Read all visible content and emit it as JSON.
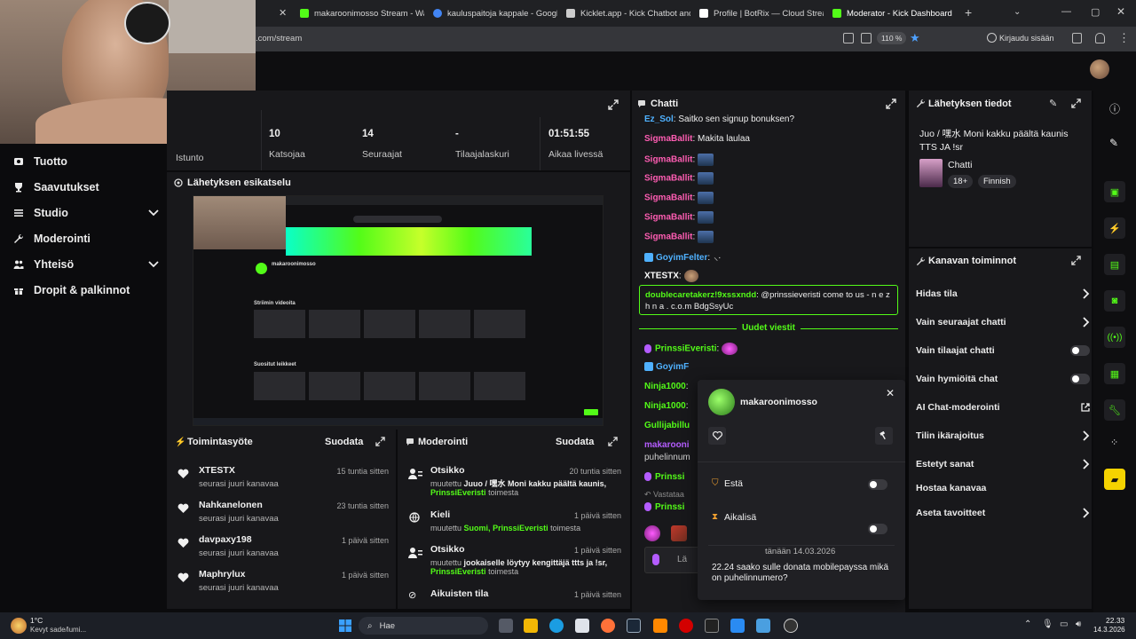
{
  "browser": {
    "tabs": [
      {
        "label": "makaroonimosso Stream - Wat",
        "favicon_color": "#53fc18"
      },
      {
        "label": "kauluspaitoja kappale - Google",
        "favicon_color": "#4285f4"
      },
      {
        "label": "Kicklet.app - Kick Chatbot and",
        "favicon_color": "#cccccc"
      },
      {
        "label": "Profile | BotRix — Cloud Stream",
        "favicon_color": "#ffffff"
      },
      {
        "label": "Moderator - Kick Dashboard",
        "favicon_color": "#53fc18"
      }
    ],
    "url_fragment": ".com/stream",
    "zoom": "110 %",
    "signin_label": "Kirjaudu sisään"
  },
  "leftnav": {
    "items": [
      {
        "label": "Tuotto",
        "icon": "dollar-icon"
      },
      {
        "label": "Saavutukset",
        "icon": "trophy-icon"
      },
      {
        "label": "Studio",
        "icon": "sliders-icon"
      },
      {
        "label": "Moderointi",
        "icon": "wrench-icon"
      },
      {
        "label": "Yhteisö",
        "icon": "people-icon"
      },
      {
        "label": "Dropit & palkinnot",
        "icon": "gift-icon"
      }
    ]
  },
  "stats": {
    "session_label": "Istunto",
    "items": [
      {
        "value": "10",
        "label": "Katsojaa"
      },
      {
        "value": "14",
        "label": "Seuraajat"
      },
      {
        "value": "-",
        "label": "Tilaajalaskuri"
      },
      {
        "value": "01:51:55",
        "label": "Aikaa livessä"
      }
    ]
  },
  "preview": {
    "title": "Lähetyksen esikatselu",
    "inner_channel": "makaroonimosso",
    "inner_section1": "Striimin videoita",
    "inner_section2": "Suositut leikkeet"
  },
  "feed": {
    "title": "Toimintasyöte",
    "filter_label": "Suodata",
    "items": [
      {
        "name": "XTESTX",
        "sub": "seurasi juuri kanavaa",
        "time": "15 tuntia sitten"
      },
      {
        "name": "Nahkanelonen",
        "sub": "seurasi juuri kanavaa",
        "time": "23 tuntia sitten"
      },
      {
        "name": "davpaxy198",
        "sub": "seurasi juuri kanavaa",
        "time": "1 päivä sitten"
      },
      {
        "name": "Maphrylux",
        "sub": "seurasi juuri kanavaa",
        "time": "1 päivä sitten"
      }
    ]
  },
  "modlog": {
    "title": "Moderointi",
    "filter_label": "Suodata",
    "items": [
      {
        "title": "Otsikko",
        "time": "20 tuntia sitten",
        "prefix": "muutettu",
        "value": "Juuo / 嘿水 Moni kakku päältä kaunis,",
        "actor": "PrinssiEveristi",
        "suffix": "toimesta"
      },
      {
        "title": "Kieli",
        "time": "1 päivä sitten",
        "prefix": "muutettu",
        "value": "Suomi,",
        "actor": "PrinssiEveristi",
        "suffix": "toimesta"
      },
      {
        "title": "Otsikko",
        "time": "1 päivä sitten",
        "prefix": "muutettu",
        "value": "jookaiselle löytyy kengittäjä ttts ja !sr,",
        "actor": "PrinssiEveristi",
        "suffix": "toimesta"
      },
      {
        "title": "Aikuisten tila",
        "time": "1 päivä sitten"
      }
    ]
  },
  "chat": {
    "title": "Chatti",
    "messages": [
      {
        "user": "Ez_Sol",
        "color": "#4fb1ff",
        "text": "Saitko sen signup bonuksen?"
      },
      {
        "user": "SigmaBallit",
        "color": "#ff5db3",
        "text": "Makita laulaa"
      },
      {
        "user": "SigmaBallit",
        "color": "#ff5db3",
        "text": ""
      },
      {
        "user": "SigmaBallit",
        "color": "#ff5db3",
        "text": ""
      },
      {
        "user": "SigmaBallit",
        "color": "#ff5db3",
        "text": ""
      },
      {
        "user": "SigmaBallit",
        "color": "#ff5db3",
        "text": ""
      },
      {
        "user": "SigmaBallit",
        "color": "#ff5db3",
        "text": ""
      },
      {
        "user": "GoyimFelter",
        "color": "#4fb1ff",
        "text": ""
      },
      {
        "user": "XTESTX",
        "color": "#ffffff",
        "text": ""
      }
    ],
    "highlight": {
      "user": "doublecaretakerz!9xssxndd",
      "text": "@prinssieveristi come to us - n e z h n a . c.o.m BdgSsyUc"
    },
    "new_messages_label": "Uudet viestit",
    "after": [
      {
        "user": "PrinssiEveristi",
        "color": "#53fc18"
      },
      {
        "user": "GoyimF",
        "color": "#4fb1ff"
      },
      {
        "user": "Ninja1000",
        "color": "#53fc18"
      },
      {
        "user": "Ninja1000",
        "color": "#53fc18"
      },
      {
        "user": "Gullijabillu",
        "color": "#53fc18"
      },
      {
        "user": "makarooni",
        "color": "#b45cff"
      },
      {
        "user": "puhelinnum",
        "color": "#cfcfcf"
      },
      {
        "user": "Prinssi",
        "color": "#53fc18"
      },
      {
        "user": "Vastataa",
        "color": "#8a8a8a"
      },
      {
        "user": "Prinssi",
        "color": "#53fc18"
      }
    ],
    "input_placeholder": "Lä"
  },
  "usercard": {
    "username": "makaroonimosso",
    "ban_label": "Estä",
    "timeout_label": "Aikalisä",
    "date_label": "tänään 14.03.2026",
    "message_time": "22.24",
    "message_text": "saako sulle donata mobilepayssa mikä on puhelinnumero?"
  },
  "streaminfo": {
    "title": "Lähetyksen tiedot",
    "stream_title": "Juo / 嘿水 Moni kakku päältä kaunis TTS JA !sr",
    "category": "Chatti",
    "badge_age": "18+",
    "badge_lang": "Finnish"
  },
  "channelactions": {
    "title": "Kanavan toiminnot",
    "items": [
      {
        "label": "Hidas tila",
        "control": "chevron"
      },
      {
        "label": "Vain seuraajat chatti",
        "control": "chevron"
      },
      {
        "label": "Vain tilaajat chatti",
        "control": "toggle"
      },
      {
        "label": "Vain hymiöitä chat",
        "control": "toggle"
      },
      {
        "label": "AI Chat-moderointi",
        "control": "external"
      },
      {
        "label": "Tilin ikärajoitus",
        "control": "chevron"
      },
      {
        "label": "Estetyt sanat",
        "control": "chevron"
      },
      {
        "label": "Hostaa kanavaa",
        "control": "none"
      },
      {
        "label": "Aseta tavoitteet",
        "control": "chevron"
      }
    ]
  },
  "taskbar": {
    "weather_temp": "1°C",
    "weather_desc": "Kevyt sade/lumi...",
    "search_label": "Hae",
    "time": "22.33",
    "date": "14.3.2026"
  },
  "colors": {
    "accent": "#53fc18",
    "panel": "#18181b",
    "bg": "#0b0b0d"
  }
}
